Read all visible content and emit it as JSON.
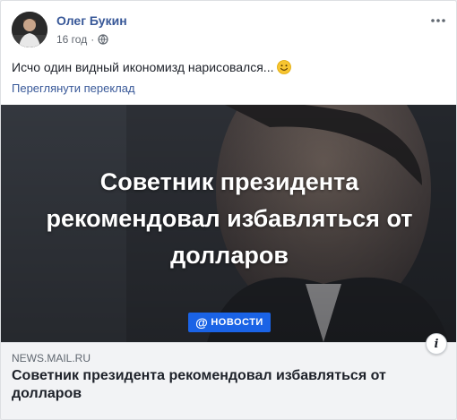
{
  "post": {
    "author": "Олег Букин",
    "time": "16 год",
    "dot": "·",
    "text": "Исчо один видный икономизд нарисовался...",
    "translate_link": "Переглянути переклад"
  },
  "link_card": {
    "image_headline_line1": "Советник президента",
    "image_headline_line2": "рекомендовал избавляться от",
    "image_headline_line3": "долларов",
    "badge_label": "НОВОСТИ",
    "badge_symbol": "@",
    "domain": "NEWS.MAIL.RU",
    "title": "Советник президента рекомендовал избавляться от долларов",
    "info_label": "i"
  },
  "colors": {
    "link_blue": "#385898",
    "badge_blue": "#1a63e6",
    "footer_bg": "#f2f3f5"
  },
  "icons": {
    "globe": "globe-icon",
    "more": "more-horizontal-icon",
    "emoji": "smiley-emoji-icon",
    "info": "info-icon"
  }
}
